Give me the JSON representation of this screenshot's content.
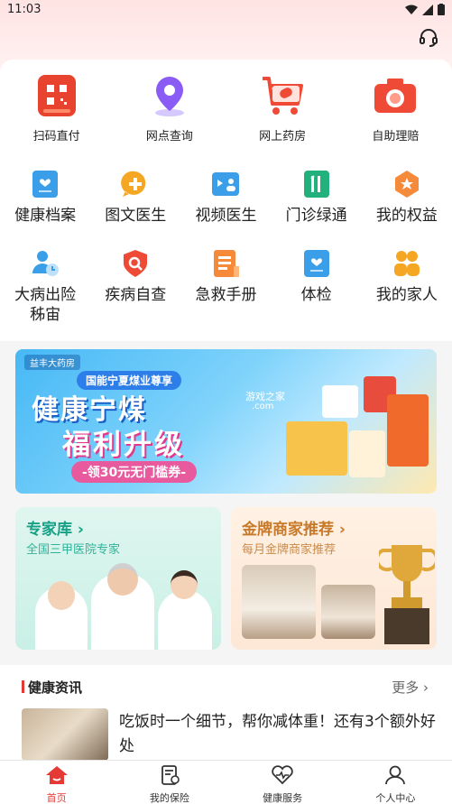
{
  "status": {
    "time": "11:03"
  },
  "quick_row": [
    {
      "label": "扫码直付",
      "icon": "qr-pay-icon"
    },
    {
      "label": "网点查询",
      "icon": "location-pin-icon"
    },
    {
      "label": "网上药房",
      "icon": "cart-icon"
    },
    {
      "label": "自助理赔",
      "icon": "camera-icon"
    }
  ],
  "service_grid": [
    {
      "label": "健康档案",
      "icon": "health-file-icon"
    },
    {
      "label": "图文医生",
      "icon": "chat-doctor-icon"
    },
    {
      "label": "视频医生",
      "icon": "video-doctor-icon"
    },
    {
      "label": "门诊绿通",
      "icon": "clinic-green-icon"
    },
    {
      "label": "我的权益",
      "icon": "benefits-icon"
    },
    {
      "label": "大病出险\n秭宙",
      "icon": "critical-illness-icon"
    },
    {
      "label": "疾病自查",
      "icon": "disease-check-icon"
    },
    {
      "label": "急救手册",
      "icon": "first-aid-icon"
    },
    {
      "label": "体检",
      "icon": "checkup-icon"
    },
    {
      "label": "我的家人",
      "icon": "family-icon"
    }
  ],
  "banner": {
    "brand": "益丰大药房",
    "subtitle": "国能宁夏煤业尊享",
    "headline1": "健康宁煤",
    "headline2": "福利升级",
    "coupon": "-领30元无门槛券-",
    "watermark": "游戏之家",
    "watermark2": ".com"
  },
  "cards": {
    "expert": {
      "title": "专家库",
      "subtitle": "全国三甲医院专家"
    },
    "merchant": {
      "title": "金牌商家推荐",
      "subtitle": "每月金牌商家推荐"
    }
  },
  "news": {
    "section_title": "健康资讯",
    "more_label": "更多",
    "headline": "吃饭时一个细节，帮你减体重！还有3个额外好处"
  },
  "tabs": [
    {
      "label": "首页",
      "icon": "home-icon"
    },
    {
      "label": "我的保险",
      "icon": "insurance-doc-icon"
    },
    {
      "label": "健康服务",
      "icon": "heart-pulse-icon"
    },
    {
      "label": "个人中心",
      "icon": "person-icon"
    }
  ],
  "colors": {
    "accent": "#e53935",
    "expert": "#16a085",
    "merchant": "#c87a2a",
    "icon_blue": "#3a9ee8",
    "icon_orange": "#f5a623"
  }
}
